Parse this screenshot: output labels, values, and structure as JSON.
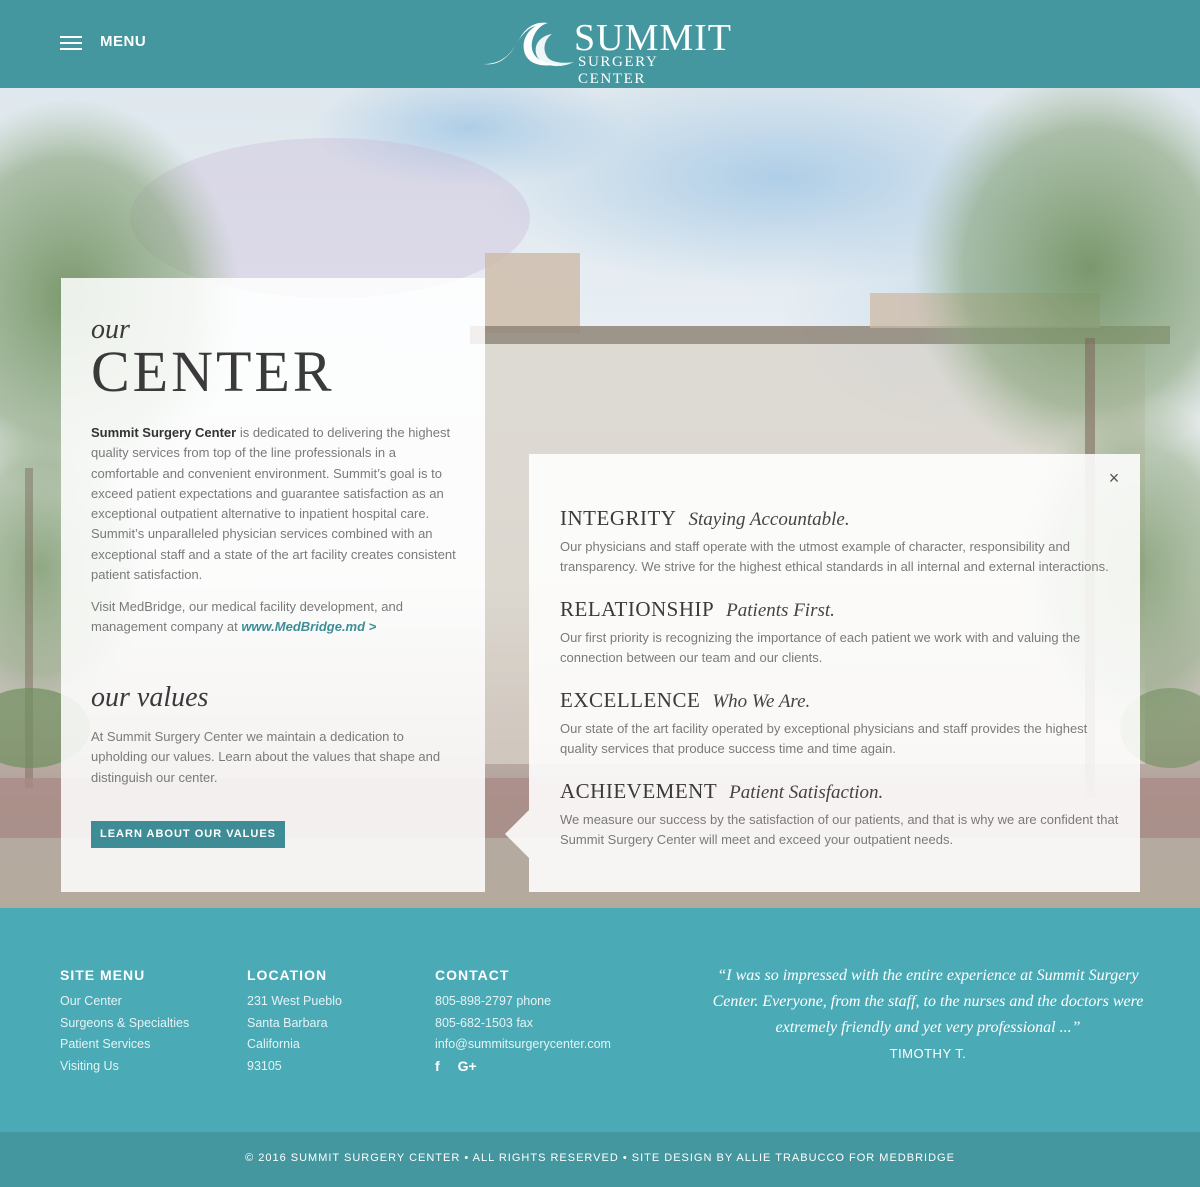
{
  "header": {
    "menu_label": "MENU",
    "logo_title": "SUMMIT",
    "logo_subtitle": "SURGERY CENTER"
  },
  "center_card": {
    "title_small": "our",
    "title_big": "CENTER",
    "intro_bold": "Summit Surgery Center",
    "intro_rest": " is dedicated to delivering the highest quality services from top of the line professionals in a comfortable and convenient environment. Summit’s goal is to exceed patient expectations and guarantee satisfaction as an exceptional outpatient alternative to inpatient hospital care. Summit’s unparalleled physician services combined with an exceptional staff and a state of the art facility creates consistent patient satisfaction.",
    "visit_text": "Visit MedBridge, our medical facility development, and management company at ",
    "visit_link": "www.MedBridge.md >",
    "values_title": "our values",
    "values_text": "At Summit Surgery Center we maintain a dedication to upholding our values. Learn about the values that shape and distinguish our center.",
    "values_button": "LEARN ABOUT OUR VALUES"
  },
  "values_card": {
    "close_label": "×",
    "values": [
      {
        "name": "INTEGRITY",
        "tagline": "Staying Accountable.",
        "description": "Our physicians and staff operate with the utmost example of character, responsibility and transparency. We strive for the highest ethical standards in all internal and external interactions."
      },
      {
        "name": "RELATIONSHIP",
        "tagline": "Patients First.",
        "description": "Our first priority is recognizing the importance of each patient we work with and valuing the connection between our team and our clients."
      },
      {
        "name": "EXCELLENCE",
        "tagline": "Who We Are.",
        "description": "Our state of the art facility operated by exceptional physicians and staff provides the highest quality services that produce success time and time again."
      },
      {
        "name": "ACHIEVEMENT",
        "tagline": "Patient Satisfaction.",
        "description": "We measure our success by the satisfaction of our patients, and that is why we are confident that Summit Surgery Center will meet and exceed your outpatient needs."
      }
    ]
  },
  "footer": {
    "site_menu": {
      "heading": "SITE MENU",
      "items": [
        "Our Center",
        "Surgeons & Specialties",
        "Patient Services",
        "Visiting Us"
      ]
    },
    "location": {
      "heading": "LOCATION",
      "lines": [
        "231 West Pueblo",
        "Santa Barbara",
        "California",
        "93105"
      ]
    },
    "contact": {
      "heading": "CONTACT",
      "phone": "805-898-2797 phone",
      "fax": "805-682-1503 fax",
      "email": "info@summitsurgerycenter.com",
      "facebook_glyph": "f",
      "googleplus_glyph": "G+"
    },
    "testimonial": {
      "quote": "“I was so impressed with the entire experience at Summit Surgery Center. Everyone, from the staff, to the nurses and the doctors were extremely friendly and yet very professional ...”",
      "author": "TIMOTHY T."
    },
    "copyright": "© 2016 SUMMIT SURGERY CENTER • ALL RIGHTS RESERVED • SITE DESIGN BY ALLIE TRABUCCO FOR MEDBRIDGE"
  },
  "colors": {
    "header_bg": "#45979f",
    "footer_bg": "#4aaab6",
    "accent": "#3e8d96"
  }
}
